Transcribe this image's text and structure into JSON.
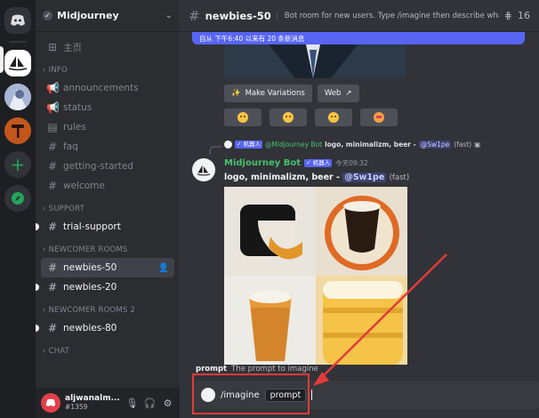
{
  "servers": {
    "home_icon": "discord-logo-icon",
    "add_icon": "plus-icon",
    "explore_icon": "compass-icon",
    "add_label": "+"
  },
  "guild": {
    "name": "Midjourney"
  },
  "channels": {
    "home": "主页",
    "cat_info": "INFO",
    "announcements": "announcements",
    "status": "status",
    "rules": "rules",
    "faq": "faq",
    "getting_started": "getting-started",
    "welcome": "welcome",
    "cat_support": "SUPPORT",
    "trial_support": "trial-support",
    "cat_newcomer": "NEWCOMER ROOMS",
    "newbies_50": "newbies-50",
    "newbies_20": "newbies-20",
    "cat_newcomer2": "NEWCOMER ROOMS 2",
    "newbies_80": "newbies-80",
    "cat_chat": "CHAT"
  },
  "user": {
    "name": "aljwanalm...",
    "tag": "#1359"
  },
  "topbar": {
    "channel": "newbies-50",
    "topic": "Bot room for new users. Type /imagine then describe what y...",
    "count": "16"
  },
  "banner": {
    "text": "自从 下午6:40 以来有 20 条新消息"
  },
  "buttons": {
    "make_variations": "Make Variations",
    "web": "Web"
  },
  "message": {
    "reply_bot": "@Midjourney Bot",
    "reply_tag": "✓ 机器人",
    "reply_text": "logo, minimalizm, beer -",
    "reply_mention": "@Sw1pe",
    "reply_suffix": "(fast)",
    "bot_name": "Midjourney Bot",
    "bot_tag": "✓ 机器人",
    "timestamp": "今天09:32",
    "prompt_text": "logo, minimalizm, beer -",
    "mention": "@Sw1pe",
    "suffix": "(fast)"
  },
  "composer": {
    "hint_label": "prompt",
    "hint_desc": "The prompt to imagine",
    "command": "/imagine",
    "option": "prompt"
  },
  "colors": {
    "accent": "#5865f2",
    "bot_green": "#47c06e",
    "highlight_red": "#e33a3a"
  }
}
